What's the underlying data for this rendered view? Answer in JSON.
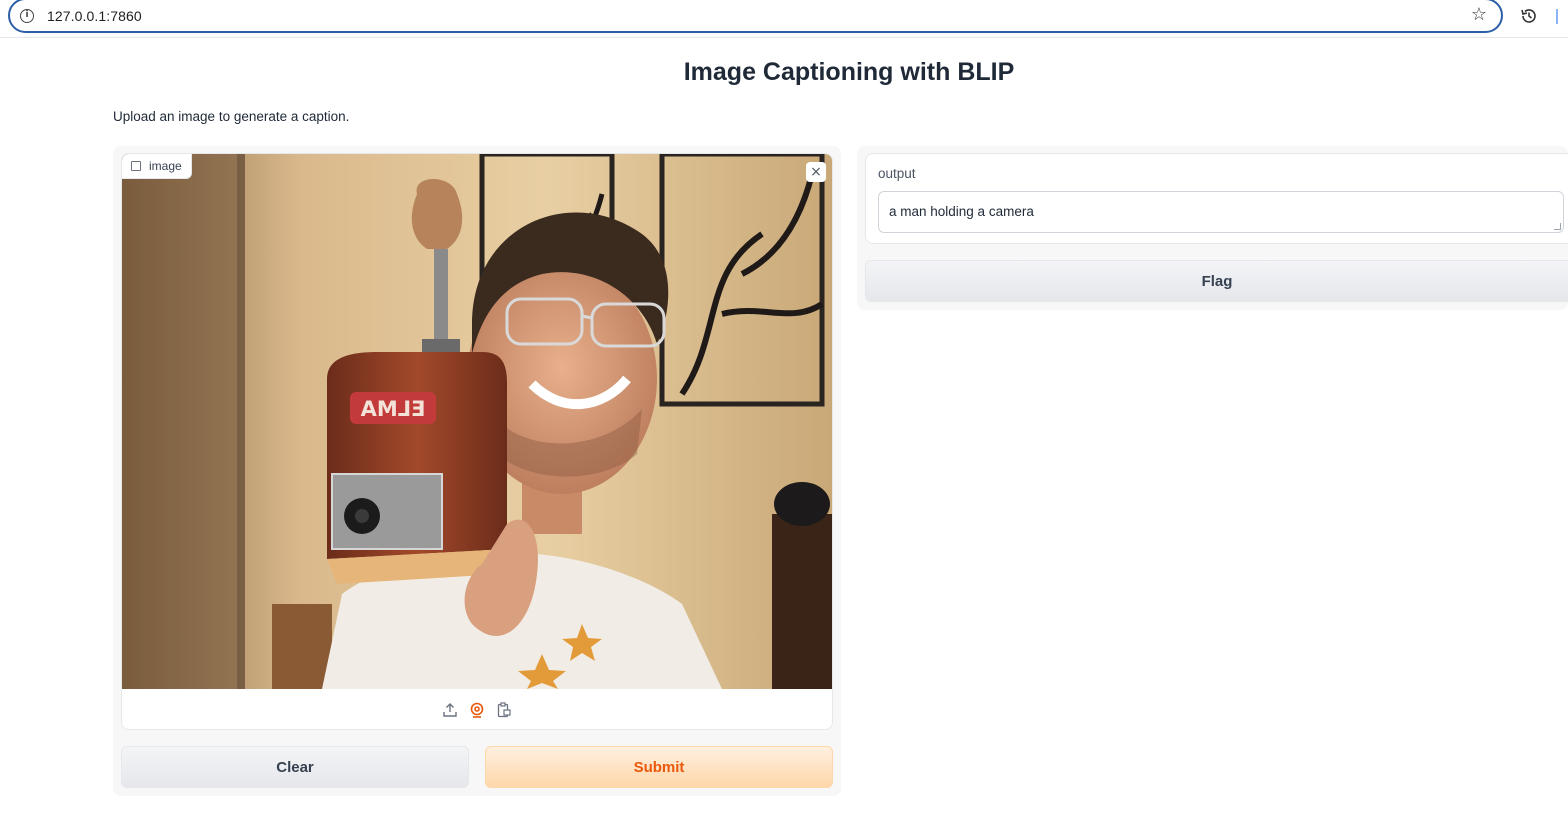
{
  "browser": {
    "url": "127.0.0.1:7860",
    "info_icon": "i"
  },
  "page": {
    "title": "Image Captioning with BLIP",
    "description": "Upload an image to generate a caption."
  },
  "input": {
    "label": "image",
    "close_symbol": "×",
    "sources": [
      "upload-icon",
      "webcam-icon",
      "clipboard-icon"
    ],
    "active_source": "webcam-icon",
    "photo_text": "ELMA"
  },
  "buttons": {
    "clear": "Clear",
    "submit": "Submit",
    "flag": "Flag"
  },
  "output": {
    "label": "output",
    "value": "a man holding a camera"
  },
  "colors": {
    "accent": "#ea580c",
    "url_border": "#2c5ea8"
  }
}
